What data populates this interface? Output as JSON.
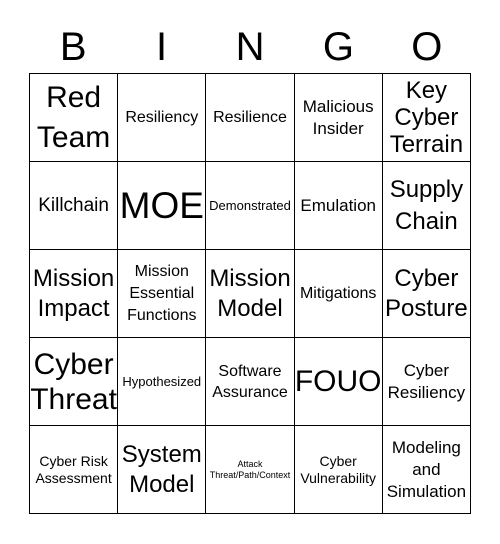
{
  "header": [
    "B",
    "I",
    "N",
    "G",
    "O"
  ],
  "cells": [
    [
      "Red\nTeam",
      "Resiliency",
      "Resilience",
      "Malicious\nInsider",
      "Key\nCyber\nTerrain"
    ],
    [
      "Killchain",
      "MOE",
      "Demonstrated",
      "Emulation",
      "Supply\nChain"
    ],
    [
      "Mission\nImpact",
      "Mission\nEssential\nFunctions",
      "Mission\nModel",
      "Mitigations",
      "Cyber\nPosture"
    ],
    [
      "Cyber\nThreat",
      "Hypothesized",
      "Software\nAssurance",
      "FOUO",
      "Cyber\nResiliency"
    ],
    [
      "Cyber Risk\nAssessment",
      "System\nModel",
      "Attack\nThreat/Path/Context",
      "Cyber\nVulnerability",
      "Modeling\nand\nSimulation"
    ]
  ]
}
